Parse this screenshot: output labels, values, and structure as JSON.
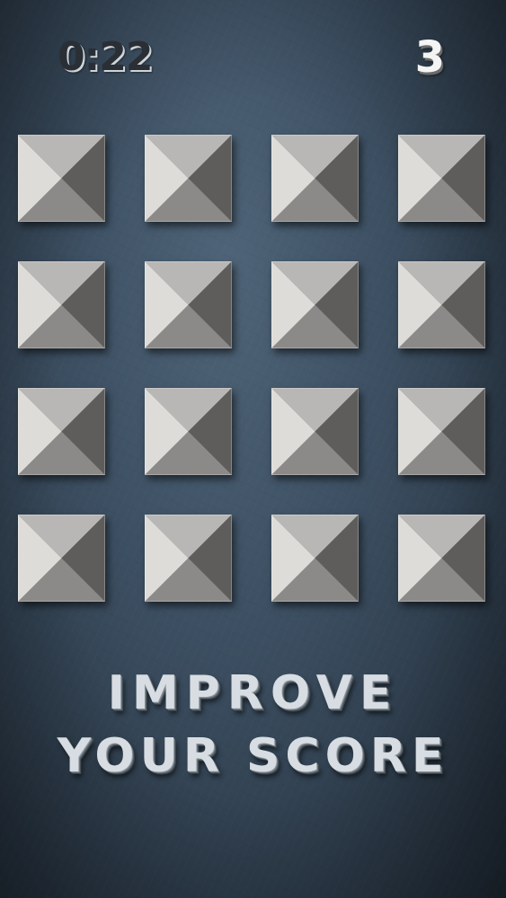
{
  "hud": {
    "timer": "0:22",
    "score": "3"
  },
  "board": {
    "rows": 4,
    "columns": 4,
    "tile_count": 16,
    "tile_colors": {
      "top": "#b9b7b5",
      "left": "#dedcd9",
      "right": "#5f5d5b",
      "bottom": "#8c8a88"
    }
  },
  "banner": {
    "line1": "IMPROVE",
    "line2": "YOUR SCORE"
  },
  "colors": {
    "background": "#3d5063",
    "timer_text": "#2a2f35",
    "score_text": "#f4f4f4",
    "banner_text": "#d7dde2"
  }
}
